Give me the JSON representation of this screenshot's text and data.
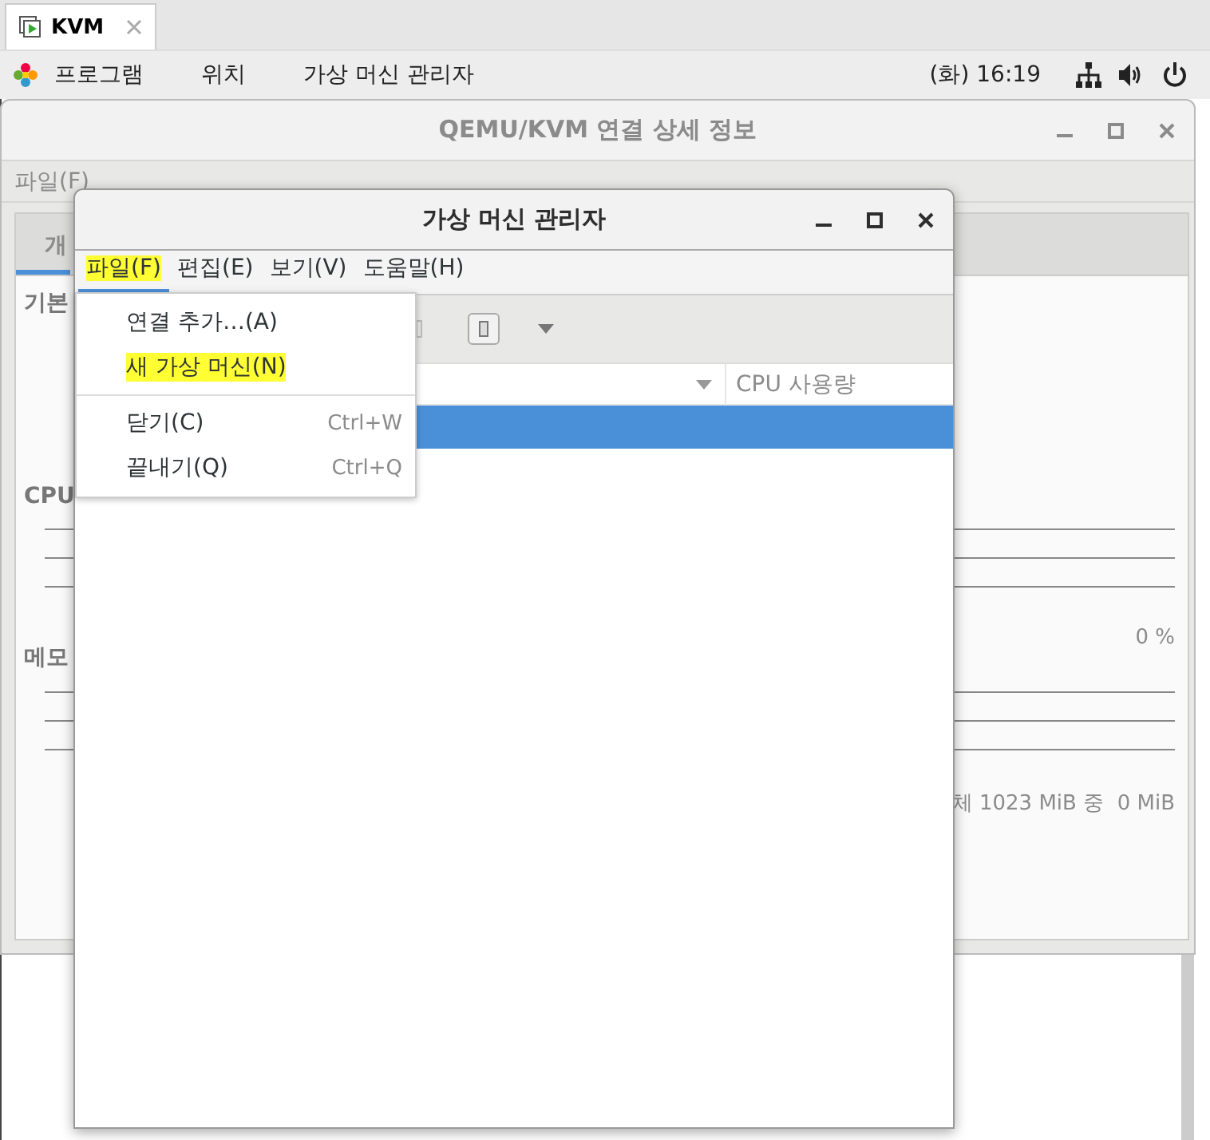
{
  "top_tab": {
    "label": "KVM"
  },
  "panel": {
    "menus": [
      "프로그램",
      "위치",
      "가상 머신 관리자"
    ],
    "clock": "(화) 16:19"
  },
  "details_window": {
    "title": "QEMU/KVM 연결 상세 정보",
    "menu": [
      "파일(F)"
    ],
    "tabs": [
      {
        "label": "개",
        "selected": true
      }
    ],
    "basic_title": "기본",
    "cpu": {
      "title": "CPU",
      "reading": "0 %"
    },
    "memory": {
      "title": "메모",
      "reading": "체 1023 MiB 중  0 MiB"
    }
  },
  "manager_window": {
    "title": "가상 머신 관리자",
    "menus": [
      {
        "label": "파일(F)",
        "selected": true,
        "highlighted": true
      },
      {
        "label": "편집(E)",
        "selected": false,
        "highlighted": false
      },
      {
        "label": "보기(V)",
        "selected": false,
        "highlighted": false
      },
      {
        "label": "도움말(H)",
        "selected": false,
        "highlighted": false
      }
    ],
    "list": {
      "column_2": "CPU 사용량",
      "rows": [
        {
          "selected": true
        }
      ]
    }
  },
  "file_menu": {
    "items": [
      {
        "kind": "item",
        "label": "연결 추가…(A)",
        "highlighted": false
      },
      {
        "kind": "item",
        "label": "새 가상 머신(N)",
        "highlighted": true
      },
      {
        "kind": "separator"
      },
      {
        "kind": "item",
        "label": "닫기(C)",
        "shortcut": "Ctrl+W",
        "highlighted": false
      },
      {
        "kind": "item",
        "label": "끝내기(Q)",
        "shortcut": "Ctrl+Q",
        "highlighted": false
      }
    ]
  }
}
